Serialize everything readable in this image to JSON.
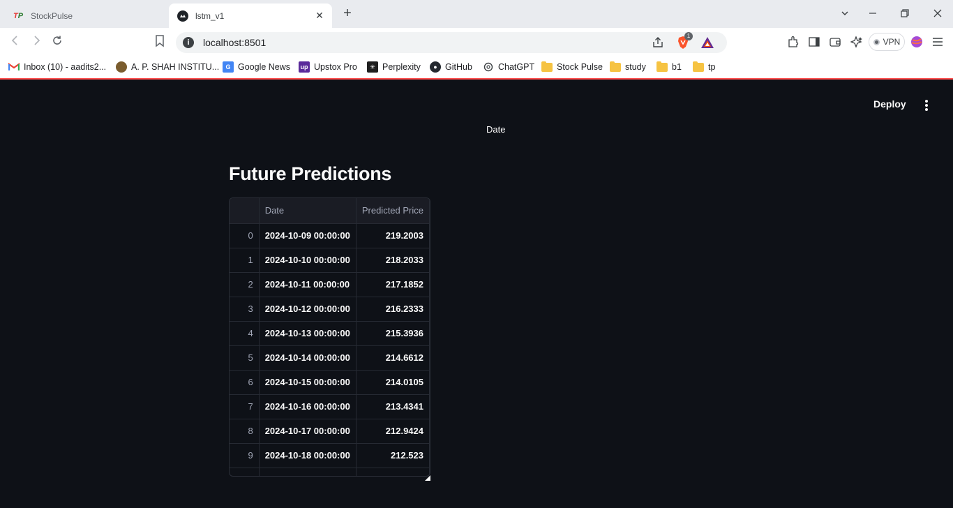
{
  "browser": {
    "tabs": [
      {
        "title": "StockPulse",
        "active": false
      },
      {
        "title": "lstm_v1",
        "active": true
      }
    ],
    "url": "localhost:8501",
    "brave_badge": "1",
    "vpn_label": "VPN",
    "bookmarks": [
      {
        "label": "Inbox (10) - aadits2...",
        "icon": "gmail-icon"
      },
      {
        "label": "A. P. SHAH INSTITU...",
        "icon": "college-logo-icon"
      },
      {
        "label": "Google News",
        "icon": "google-news-icon"
      },
      {
        "label": "Upstox Pro",
        "icon": "upstox-icon"
      },
      {
        "label": "Perplexity",
        "icon": "perplexity-icon"
      },
      {
        "label": "GitHub",
        "icon": "github-icon"
      },
      {
        "label": "ChatGPT",
        "icon": "chatgpt-icon"
      },
      {
        "label": "Stock Pulse",
        "icon": "folder-icon"
      },
      {
        "label": "study",
        "icon": "folder-icon"
      },
      {
        "label": "b1",
        "icon": "folder-icon"
      },
      {
        "label": "tp",
        "icon": "folder-icon"
      }
    ]
  },
  "app": {
    "deploy_label": "Deploy",
    "chart_axis_label": "Date",
    "heading": "Future Predictions",
    "table": {
      "columns": [
        "",
        "Date",
        "Predicted Price"
      ],
      "rows": [
        {
          "index": "0",
          "date": "2024-10-09 00:00:00",
          "price": "219.2003"
        },
        {
          "index": "1",
          "date": "2024-10-10 00:00:00",
          "price": "218.2033"
        },
        {
          "index": "2",
          "date": "2024-10-11 00:00:00",
          "price": "217.1852"
        },
        {
          "index": "3",
          "date": "2024-10-12 00:00:00",
          "price": "216.2333"
        },
        {
          "index": "4",
          "date": "2024-10-13 00:00:00",
          "price": "215.3936"
        },
        {
          "index": "5",
          "date": "2024-10-14 00:00:00",
          "price": "214.6612"
        },
        {
          "index": "6",
          "date": "2024-10-15 00:00:00",
          "price": "214.0105"
        },
        {
          "index": "7",
          "date": "2024-10-16 00:00:00",
          "price": "213.4341"
        },
        {
          "index": "8",
          "date": "2024-10-17 00:00:00",
          "price": "212.9424"
        },
        {
          "index": "9",
          "date": "2024-10-18 00:00:00",
          "price": "212.523"
        }
      ]
    }
  },
  "colors": {
    "app_bg": "#0e1117",
    "accent_line": "#ff4b4b",
    "text": "#fafafa"
  }
}
